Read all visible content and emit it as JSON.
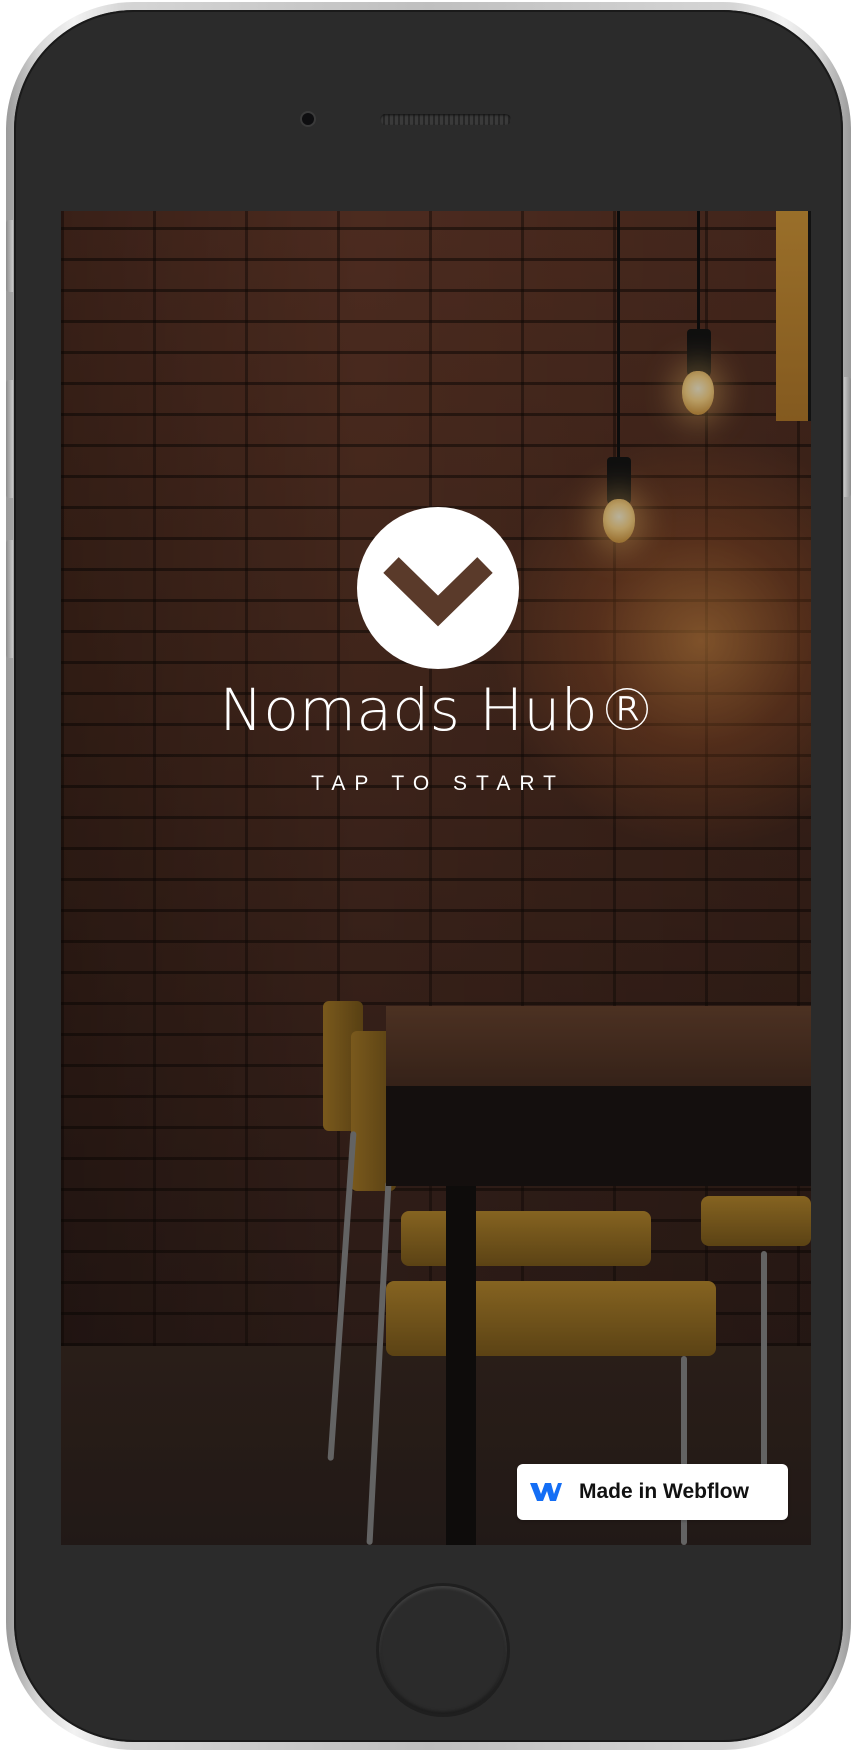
{
  "app": {
    "title": "Nomads Hub®",
    "call_to_action": "TAP TO START",
    "logo_icon": "chevron-down-icon"
  },
  "badge": {
    "label": "Made in Webflow",
    "icon": "webflow-logo-icon",
    "icon_color": "#146EF5"
  },
  "colors": {
    "text": "#FFFFFF",
    "logo_background": "#FFFFFF",
    "logo_chevron": "#5A3A2A",
    "device_body": "#2B2B2B"
  }
}
